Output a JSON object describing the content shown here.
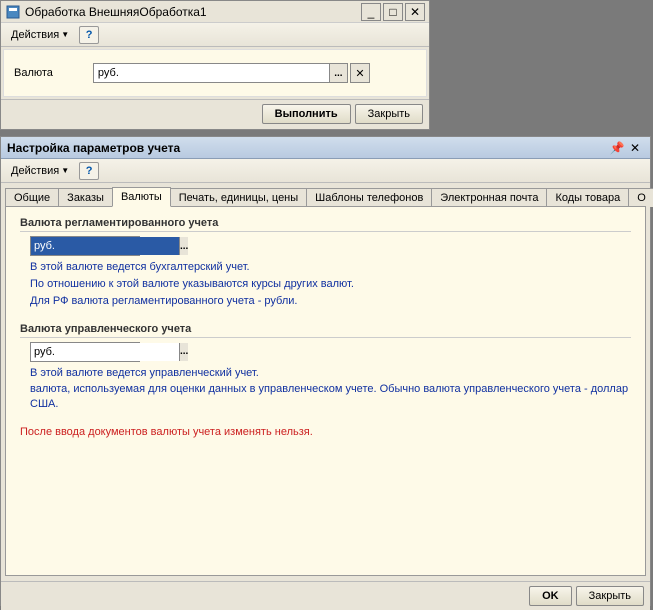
{
  "window1": {
    "title": "Обработка  ВнешняяОбработка1",
    "actions_label": "Действия",
    "currency_label": "Валюта",
    "currency_value": "руб.",
    "execute_btn": "Выполнить",
    "close_btn": "Закрыть"
  },
  "window2": {
    "title": "Настройка параметров учета",
    "actions_label": "Действия",
    "tabs": [
      "Общие",
      "Заказы",
      "Валюты",
      "Печать, единицы, цены",
      "Шаблоны телефонов",
      "Электронная почта",
      "Коды товара",
      "О"
    ],
    "active_tab": 2,
    "section1": {
      "title": "Валюта регламентированного учета",
      "value": "руб.",
      "desc1": "В этой валюте ведется бухгалтерский учет.",
      "desc2": "По отношению к этой валюте указываются курсы других валют.",
      "desc3": "Для РФ валюта регламентированного учета - рубли."
    },
    "section2": {
      "title": "Валюта управленческого учета",
      "value": "руб.",
      "desc1": "В этой валюте ведется управленческий учет.",
      "desc2": "валюта, используемая для оценки данных в управленческом учете. Обычно валюта управленческого учета - доллар США."
    },
    "warning": "После ввода документов валюты учета изменять нельзя.",
    "ok_btn": "OK",
    "close_btn": "Закрыть"
  }
}
